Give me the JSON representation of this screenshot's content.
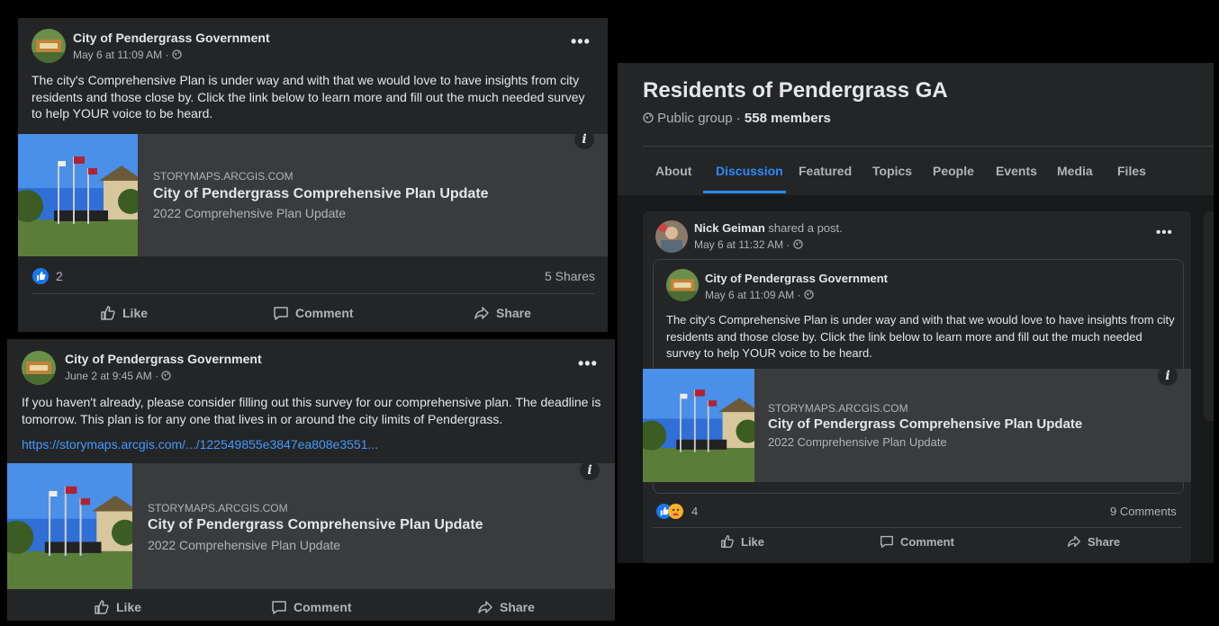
{
  "post1": {
    "author": "City of Pendergrass Government",
    "time": "May 6 at 11:09 AM ·",
    "text": "The city's Comprehensive Plan is under way and with that we would love to have insights from city residents and those close by. Click the link below to learn more and fill out the much needed survey to help YOUR voice to be heard.",
    "link": {
      "site": "STORYMAPS.ARCGIS.COM",
      "title": "City of Pendergrass Comprehensive Plan Update",
      "subtitle": "2022 Comprehensive Plan Update"
    },
    "reactions": "2",
    "shares": "5 Shares",
    "actions": {
      "like": "Like",
      "comment": "Comment",
      "share": "Share"
    }
  },
  "post2": {
    "author": "City of Pendergrass Government",
    "time": "June 2 at 9:45 AM ·",
    "text": "If you haven't already, please consider filling out this survey for our comprehensive plan. The deadline is tomorrow. This plan is for any one that lives in or around the city limits of Pendergrass.",
    "url": "https://storymaps.arcgis.com/.../122549855e3847ea808e3551...",
    "link": {
      "site": "STORYMAPS.ARCGIS.COM",
      "title": "City of Pendergrass Comprehensive Plan Update",
      "subtitle": "2022 Comprehensive Plan Update"
    },
    "actions": {
      "like": "Like",
      "comment": "Comment",
      "share": "Share"
    }
  },
  "group": {
    "name": "Residents of Pendergrass GA",
    "privacy": "Public group · ",
    "members": "558 members",
    "tabs": [
      "About",
      "Discussion",
      "Featured",
      "Topics",
      "People",
      "Events",
      "Media",
      "Files"
    ],
    "active_tab": "Discussion",
    "shared": {
      "sharer": "Nick Geiman",
      "verb": " shared a post.",
      "time": "May 6 at 11:32 AM ·",
      "inner_author": "City of Pendergrass Government",
      "inner_time": "May 6 at 11:09 AM ·",
      "text": "The city's Comprehensive Plan is under way and with that we would love to have insights from city residents and those close by. Click the link below to learn more and fill out the much needed survey to help YOUR voice to be heard.",
      "link": {
        "site": "STORYMAPS.ARCGIS.COM",
        "title": "City of Pendergrass Comprehensive Plan Update",
        "subtitle": "2022 Comprehensive Plan Update"
      },
      "reactions": "4",
      "comments": "9 Comments",
      "actions": {
        "like": "Like",
        "comment": "Comment",
        "share": "Share"
      }
    }
  },
  "colors": {
    "bg": "#242526",
    "card": "#3a3b3c",
    "accent": "#2d88ff",
    "link": "#4599ff"
  },
  "icons": [
    "globe-icon",
    "more-icon",
    "info-icon",
    "like-icon",
    "comment-icon",
    "share-icon",
    "like-reaction-icon",
    "care-reaction-icon"
  ]
}
